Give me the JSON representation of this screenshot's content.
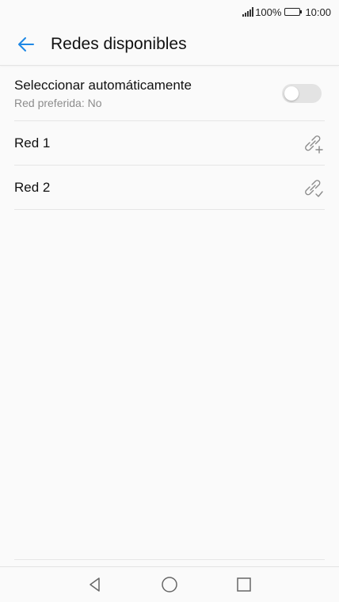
{
  "status_bar": {
    "battery_percent": "100%",
    "time": "10:00",
    "signal_icon": "signal-icon",
    "battery_icon": "battery-icon"
  },
  "header": {
    "title": "Redes disponibles",
    "back_icon": "back-arrow-icon"
  },
  "auto_select": {
    "label": "Seleccionar automáticamente",
    "subtitle": "Red preferida: No",
    "enabled": false
  },
  "networks": [
    {
      "name": "Red 1",
      "icon": "link-add-icon"
    },
    {
      "name": "Red 2",
      "icon": "link-check-icon"
    }
  ],
  "nav_bar": {
    "back": "nav-back-icon",
    "home": "nav-home-icon",
    "recents": "nav-recents-icon"
  },
  "colors": {
    "accent": "#1e88e5",
    "background": "#fafafa",
    "divider": "#e6e6e6",
    "secondary_text": "#8c8c8c"
  }
}
